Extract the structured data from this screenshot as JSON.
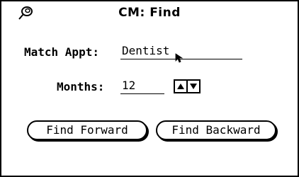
{
  "window": {
    "title": "CM: Find"
  },
  "icons": {
    "pushpin": "pushpin-icon",
    "cursor": "text-cursor-icon",
    "spin_up": "triangle-up-icon",
    "spin_down": "triangle-down-icon"
  },
  "match": {
    "label": "Match Appt:",
    "value": "Dentist"
  },
  "months": {
    "label": "Months:",
    "value": "12"
  },
  "buttons": {
    "find_forward": "Find Forward",
    "find_backward": "Find Backward"
  },
  "colors": {
    "background": "#ffffff",
    "foreground": "#000000"
  }
}
